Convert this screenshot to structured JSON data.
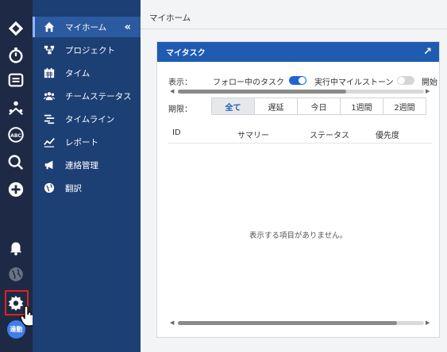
{
  "rail": {
    "icons": [
      "logo-icon",
      "timer-icon",
      "folder-icon",
      "team-icon",
      "abc-icon",
      "search-icon",
      "plus-icon",
      "bell-icon",
      "globe-icon",
      "gear-icon"
    ],
    "avatar_text": "達動"
  },
  "nav": {
    "items": [
      {
        "label": "マイホーム",
        "icon": "home-icon"
      },
      {
        "label": "プロジェクト",
        "icon": "project-icon"
      },
      {
        "label": "タイム",
        "icon": "calendar-icon"
      },
      {
        "label": "チームステータス",
        "icon": "users-icon"
      },
      {
        "label": "タイムライン",
        "icon": "timeline-icon"
      },
      {
        "label": "レポート",
        "icon": "chart-icon"
      },
      {
        "label": "連絡管理",
        "icon": "megaphone-icon"
      },
      {
        "label": "翻訳",
        "icon": "translate-icon"
      }
    ],
    "collapse": "«"
  },
  "breadcrumb": "マイホーム",
  "card": {
    "title": "マイタスク",
    "expand": "↗",
    "show_label": "表示：",
    "follow_label": "フォロー中のタスク",
    "follow_on": true,
    "milestone_label": "実行中マイルストーン",
    "milestone_on": false,
    "open_label": "開始",
    "limit_label": "期限：",
    "tabs": [
      "全て",
      "遅延",
      "今日",
      "1週間",
      "2週間"
    ],
    "active_tab": "全て",
    "columns": [
      "ID",
      "サマリー",
      "ステータス",
      "優先度"
    ],
    "empty_message": "表示する項目がありません。"
  }
}
